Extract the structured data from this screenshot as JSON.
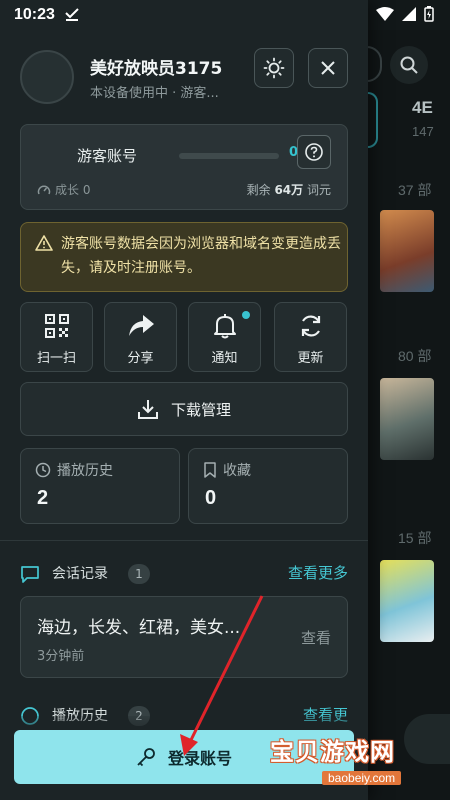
{
  "status_bar": {
    "time": "10:23"
  },
  "background": {
    "stat_label": "4E",
    "stat_sub": "147",
    "counts": [
      "37 部",
      "80 部",
      "15 部"
    ],
    "thumb_colors": [
      "#a86b3c",
      "#6d7a73",
      "#c9d24a"
    ]
  },
  "profile": {
    "name": "美好放映员3175",
    "subtitle": "本设备使用中 · 游客..."
  },
  "guest": {
    "title": "游客账号",
    "progress_percent": 0,
    "progress_label": "0%",
    "growth": "成长 0",
    "remaining_prefix": "剩余",
    "remaining_value": "64万",
    "remaining_suffix": "词元"
  },
  "warning": {
    "text": "游客账号数据会因为浏览器和域名变更造成丢失，请及时注册账号。"
  },
  "tiles": [
    {
      "label": "扫一扫",
      "icon": "qr-scan-icon"
    },
    {
      "label": "分享",
      "icon": "share-icon"
    },
    {
      "label": "通知",
      "icon": "bell-icon"
    },
    {
      "label": "更新",
      "icon": "refresh-icon"
    }
  ],
  "download": {
    "label": "下载管理",
    "icon": "download-icon"
  },
  "stats": [
    {
      "label": "播放历史",
      "value": "2",
      "icon": "clock-icon"
    },
    {
      "label": "收藏",
      "value": "0",
      "icon": "bookmark-icon"
    }
  ],
  "conversations": {
    "title": "会话记录",
    "count": "1",
    "more": "查看更多",
    "item": {
      "text": "海边，长发、红裙，美女...",
      "time": "3分钟前",
      "view": "查看"
    }
  },
  "history_section": {
    "title": "播放历史",
    "count": "2",
    "more": "查看更"
  },
  "login": {
    "label": "登录账号",
    "icon": "key-icon"
  },
  "watermark": {
    "main": "宝贝游戏网",
    "sub": "baobeiy.com"
  },
  "colors": {
    "accent": "#30b9c6",
    "login_bg": "#8fe4ec",
    "warning_bg": "#3b3822",
    "annotation": "#e0242a"
  }
}
